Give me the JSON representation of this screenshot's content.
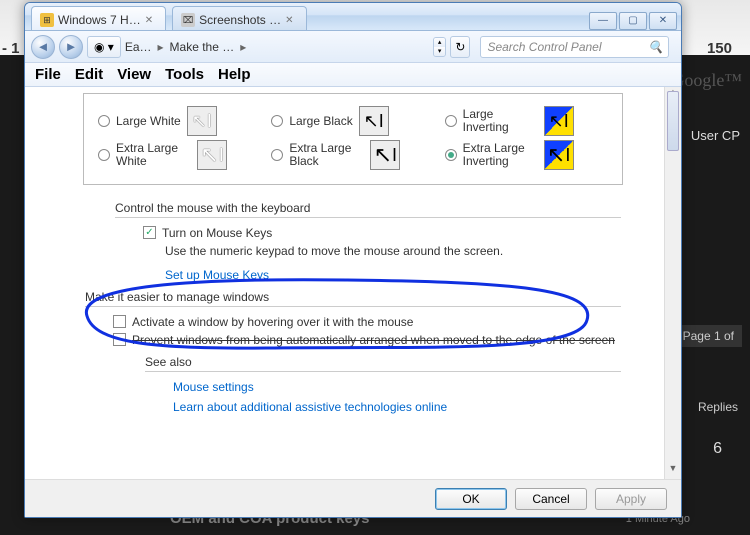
{
  "bg": {
    "url_hint": "/search.php?searchid=6",
    "page_num_left": "- 1",
    "page_num_right": "150",
    "google": "Google™",
    "usercp": "User CP",
    "page_of": "Page 1 of",
    "replies": "Replies",
    "six": "6",
    "oem": "OEM and COA product keys",
    "ago": "1 Minute Ago"
  },
  "tabs": [
    {
      "label": "Windows 7 H…",
      "active": true
    },
    {
      "label": "Screenshots …",
      "active": false
    }
  ],
  "winbtns": {
    "min": "—",
    "max": "▢",
    "close": "✕"
  },
  "nav": {
    "crumb1": "Ea…",
    "crumb2": "Make the …",
    "search_placeholder": "Search Control Panel"
  },
  "menu": [
    "File",
    "Edit",
    "View",
    "Tools",
    "Help"
  ],
  "cursors": {
    "row1": [
      {
        "label": "Large White",
        "sel": false,
        "style": "white"
      },
      {
        "label": "Large Black",
        "sel": false,
        "style": "black"
      },
      {
        "label": "Large Inverting",
        "sel": false,
        "style": "inv"
      }
    ],
    "row2": [
      {
        "label": "Extra Large White",
        "sel": false,
        "style": "white"
      },
      {
        "label": "Extra Large Black",
        "sel": false,
        "style": "black"
      },
      {
        "label": "Extra Large Inverting",
        "sel": true,
        "style": "inv"
      }
    ]
  },
  "mouse_section": {
    "legend": "Control the mouse with the keyboard",
    "chk_mousekeys": {
      "label": "Turn on Mouse Keys",
      "checked": true
    },
    "hint": "Use the numeric keypad to move the mouse around the screen.",
    "link_setup": "Set up Mouse Keys"
  },
  "windows_section": {
    "legend": "Make it easier to manage windows",
    "chk_hover": {
      "label": "Activate a window by hovering over it with the mouse",
      "checked": false
    },
    "chk_snap": {
      "label": "Prevent windows from being automatically arranged when moved to the edge of the screen",
      "checked": false
    }
  },
  "seealso": {
    "legend": "See also",
    "link_mouse": "Mouse settings",
    "link_assistive": "Learn about additional assistive technologies online"
  },
  "buttons": {
    "ok": "OK",
    "cancel": "Cancel",
    "apply": "Apply"
  }
}
